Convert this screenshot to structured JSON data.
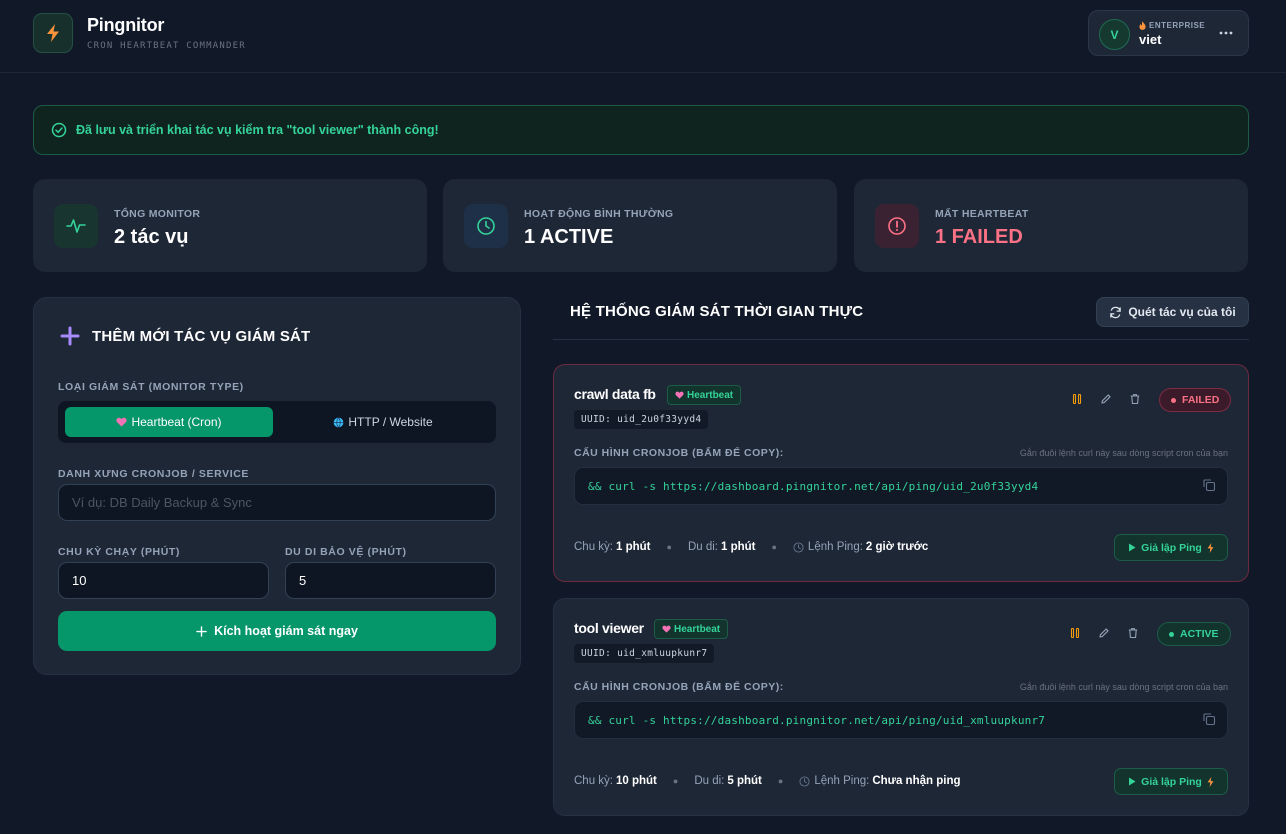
{
  "app": {
    "name": "Pingnitor",
    "tagline": "CRON HEARTBEAT COMMANDER"
  },
  "user": {
    "initial": "V",
    "plan": "ENTERPRISE",
    "name": "viet"
  },
  "alert": {
    "message": "Đã lưu và triển khai tác vụ kiểm tra \"tool viewer\" thành công!"
  },
  "stats": [
    {
      "label": "TỔNG MONITOR",
      "value": "2 tác vụ",
      "icon": "pulse-icon",
      "color": "#34d399"
    },
    {
      "label": "HOẠT ĐỘNG BÌNH THƯỜNG",
      "value": "1 ACTIVE",
      "icon": "clock-icon",
      "color": "#34d399"
    },
    {
      "label": "MẤT HEARTBEAT",
      "value": "1 FAILED",
      "icon": "alert-circle-icon",
      "color": "#fb7185"
    }
  ],
  "form": {
    "title": "THÊM MỚI TÁC VỤ GIÁM SÁT",
    "monitor_type_label": "LOẠI GIÁM SÁT (MONITOR TYPE)",
    "type_options": [
      {
        "label": "Heartbeat (Cron)",
        "selected": true
      },
      {
        "label": "HTTP / Website",
        "selected": false
      }
    ],
    "name_label": "DANH XƯNG CRONJOB / SERVICE",
    "name_placeholder": "Ví dụ: DB Daily Backup & Sync",
    "name_value": "",
    "interval_label": "CHU KỲ CHẠY (PHÚT)",
    "interval_value": "10",
    "grace_label": "DU DI BẢO VỆ (PHÚT)",
    "grace_value": "5",
    "submit_label": "Kích hoạt giám sát ngay"
  },
  "monitors_section": {
    "title": "HỆ THỐNG GIÁM SÁT THỜI GIAN THỰC",
    "scan_label": "Quét tác vụ của tôi"
  },
  "monitors": [
    {
      "name": "crawl data fb",
      "type": "Heartbeat",
      "uuid": "UUID: uid_2u0f33yyd4",
      "status": "FAILED",
      "cron_label": "CẤU HÌNH CRONJOB (BẤM ĐỂ COPY):",
      "cron_hint": "Gắn đuôi lệnh curl này sau dòng script cron của bạn",
      "cron_cmd": "&& curl -s https://dashboard.pingnitor.net/api/ping/uid_2u0f33yyd4",
      "interval_label": "Chu kỳ:",
      "interval": "1 phút",
      "grace_label": "Du di:",
      "grace": "1 phút",
      "ping_label": "Lệnh Ping:",
      "last_ping": "2 giờ trước",
      "simulate_label": "Giả lập Ping"
    },
    {
      "name": "tool viewer",
      "type": "Heartbeat",
      "uuid": "UUID: uid_xmluupkunr7",
      "status": "ACTIVE",
      "cron_label": "CẤU HÌNH CRONJOB (BẤM ĐỂ COPY):",
      "cron_hint": "Gắn đuôi lệnh curl này sau dòng script cron của bạn",
      "cron_cmd": "&& curl -s https://dashboard.pingnitor.net/api/ping/uid_xmluupkunr7",
      "interval_label": "Chu kỳ:",
      "interval": "10 phút",
      "grace_label": "Du di:",
      "grace": "5 phút",
      "ping_label": "Lệnh Ping:",
      "last_ping": "Chưa nhận ping",
      "simulate_label": "Giả lập Ping"
    }
  ],
  "colors": {
    "background": "#111827",
    "card": "#1e2736",
    "accent": "#059669",
    "success": "#34d399",
    "danger": "#fb7185",
    "warning": "#f59e0b"
  }
}
